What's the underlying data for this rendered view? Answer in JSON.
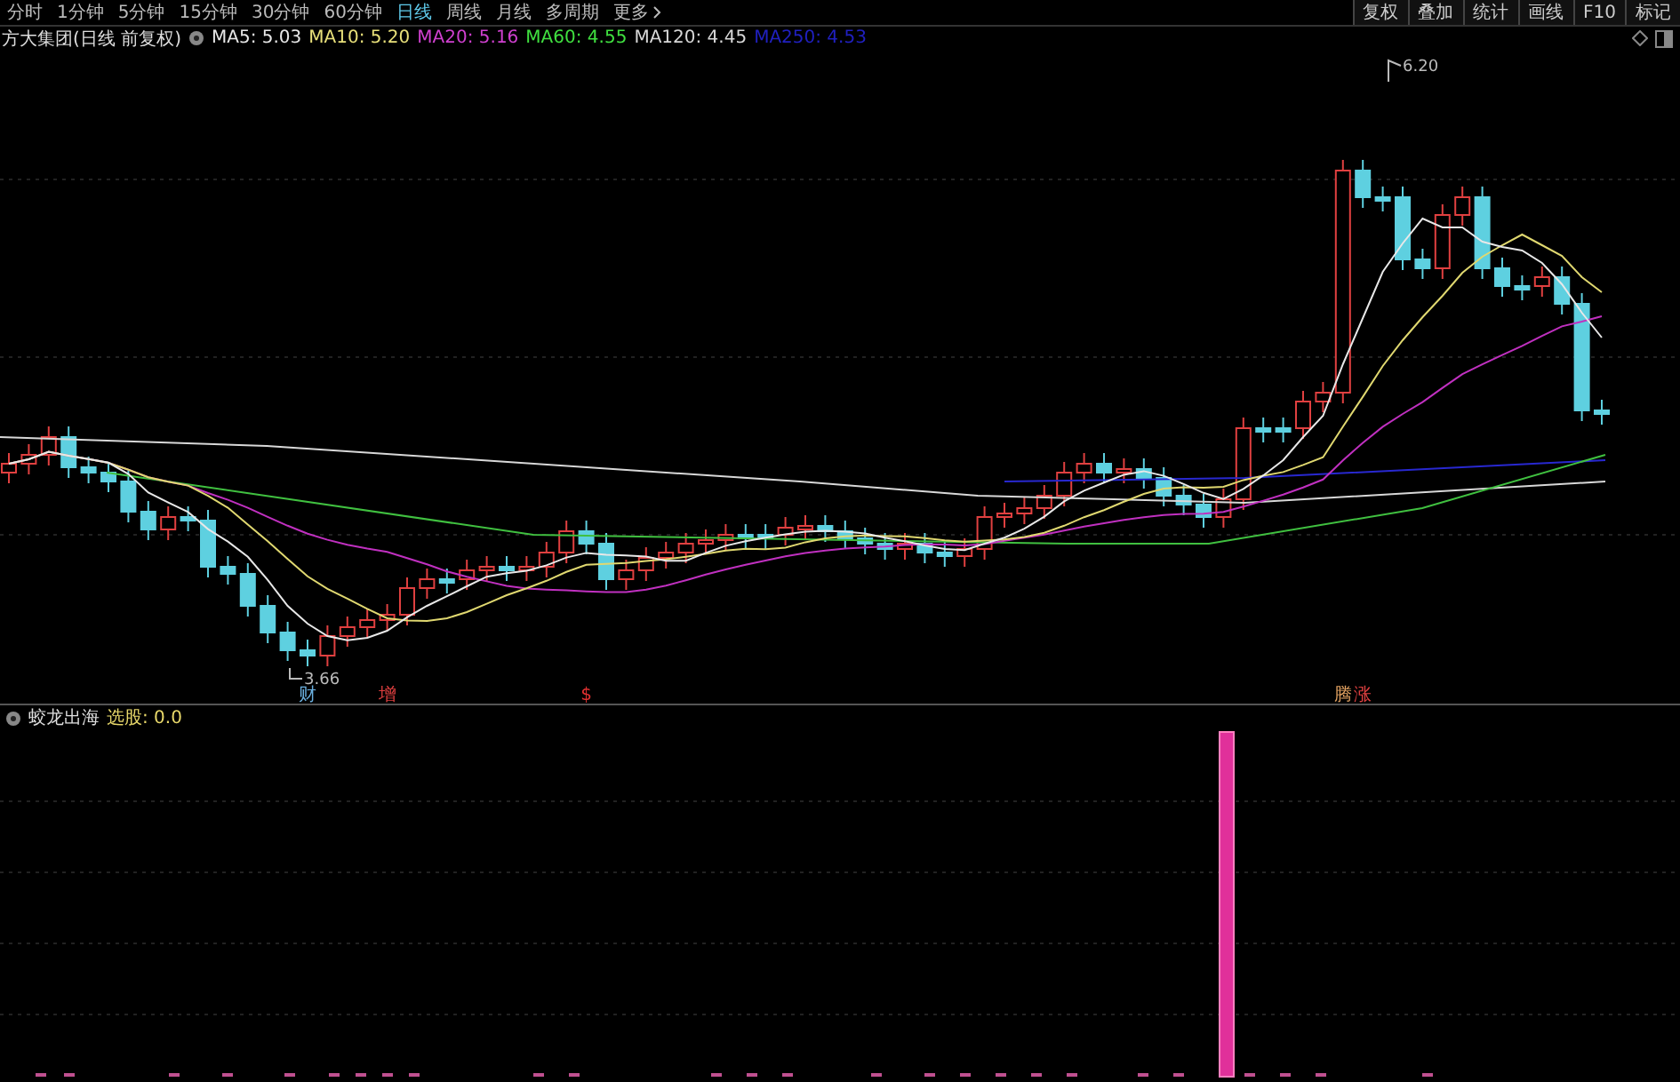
{
  "period_tabs": [
    {
      "label": "分时",
      "selected": false
    },
    {
      "label": "1分钟",
      "selected": false
    },
    {
      "label": "5分钟",
      "selected": false
    },
    {
      "label": "15分钟",
      "selected": false
    },
    {
      "label": "30分钟",
      "selected": false
    },
    {
      "label": "60分钟",
      "selected": false
    },
    {
      "label": "日线",
      "selected": true
    },
    {
      "label": "周线",
      "selected": false
    },
    {
      "label": "月线",
      "selected": false
    },
    {
      "label": "多周期",
      "selected": false
    },
    {
      "label": "更多",
      "selected": false
    }
  ],
  "tool_buttons": [
    "复权",
    "叠加",
    "统计",
    "画线",
    "F10",
    "标记"
  ],
  "stock_title": "方大集团(日线 前复权)",
  "ma_legend": [
    {
      "label": "MA5: 5.03",
      "color": "#e8e8e8"
    },
    {
      "label": "MA10: 5.20",
      "color": "#e8e07a"
    },
    {
      "label": "MA20: 5.16",
      "color": "#d040d0"
    },
    {
      "label": "MA60: 4.55",
      "color": "#40e040"
    },
    {
      "label": "MA120: 4.45",
      "color": "#d8d8d8"
    },
    {
      "label": "MA250: 4.53",
      "color": "#2020c0"
    }
  ],
  "price_labels": {
    "low": "3.66",
    "high": "6.20"
  },
  "event_marks": [
    {
      "text": "财",
      "color": "#6ab0e0"
    },
    {
      "text": "增",
      "color": "#e04040"
    },
    {
      "text": "$",
      "color": "#e03030"
    },
    {
      "text": "腾",
      "color": "#e0a060"
    },
    {
      "text": "涨",
      "color": "#e04040"
    }
  ],
  "indicator": {
    "name": "蛟龙出海",
    "output": "选股: 0.0"
  }
}
